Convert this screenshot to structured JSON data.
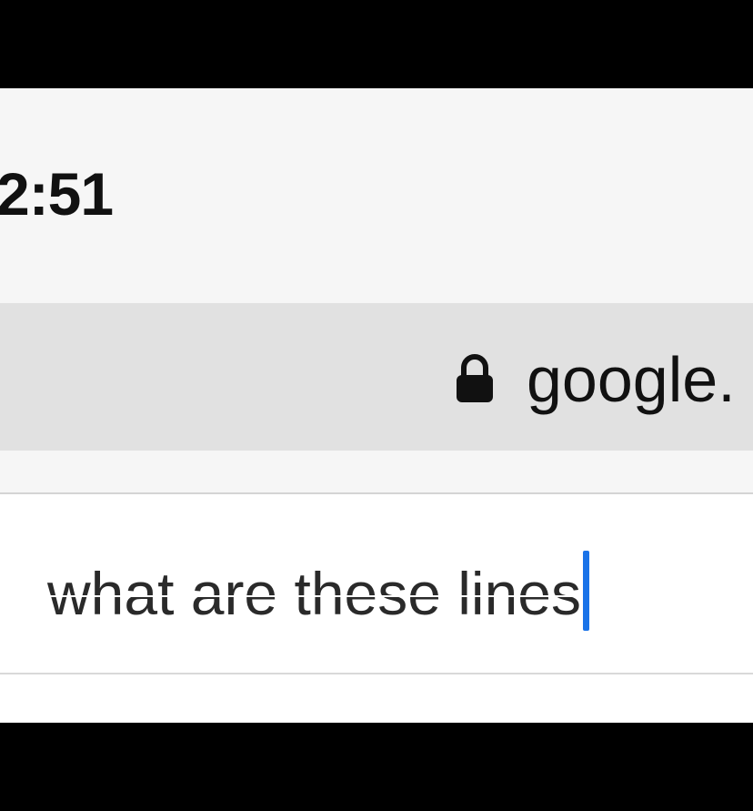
{
  "status_bar": {
    "time": "2:51"
  },
  "address_bar": {
    "lock_icon": "lock-icon",
    "url": "google."
  },
  "search": {
    "query": "what are these lines",
    "caret_color": "#1a73e8"
  }
}
